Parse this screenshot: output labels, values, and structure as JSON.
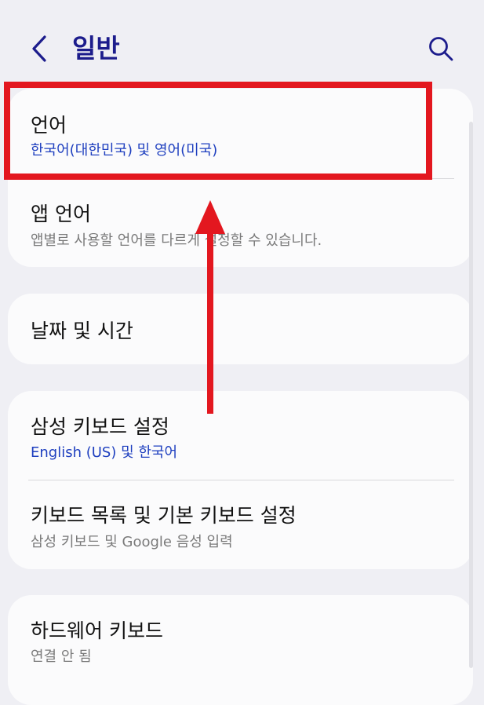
{
  "header": {
    "title": "일반",
    "back_icon": "chevron-left-icon",
    "search_icon": "search-icon"
  },
  "sections": [
    {
      "items": [
        {
          "title": "언어",
          "subtitle": "한국어(대한민국) 및 영어(미국)",
          "subtitle_style": "accent"
        },
        {
          "title": "앱 언어",
          "subtitle": "앱별로 사용할 언어를 다르게 설정할 수 있습니다.",
          "subtitle_style": "secondary"
        }
      ]
    },
    {
      "items": [
        {
          "title": "날짜 및 시간"
        }
      ]
    },
    {
      "items": [
        {
          "title": "삼성 키보드 설정",
          "subtitle": "English (US) 및 한국어",
          "subtitle_style": "accent"
        },
        {
          "title": "키보드 목록 및 기본 키보드 설정",
          "subtitle": "삼성 키보드 및 Google 음성 입력",
          "subtitle_style": "secondary"
        }
      ]
    },
    {
      "items": [
        {
          "title": "하드웨어 키보드",
          "subtitle": "연결 안 됨",
          "subtitle_style": "secondary"
        }
      ]
    }
  ],
  "colors": {
    "title": "#1c1c8c",
    "accent": "#1e3fbf",
    "secondary": "#7a7a7a",
    "background": "#efeff4",
    "card": "#fbfbfc",
    "annotation": "#e3171f"
  }
}
